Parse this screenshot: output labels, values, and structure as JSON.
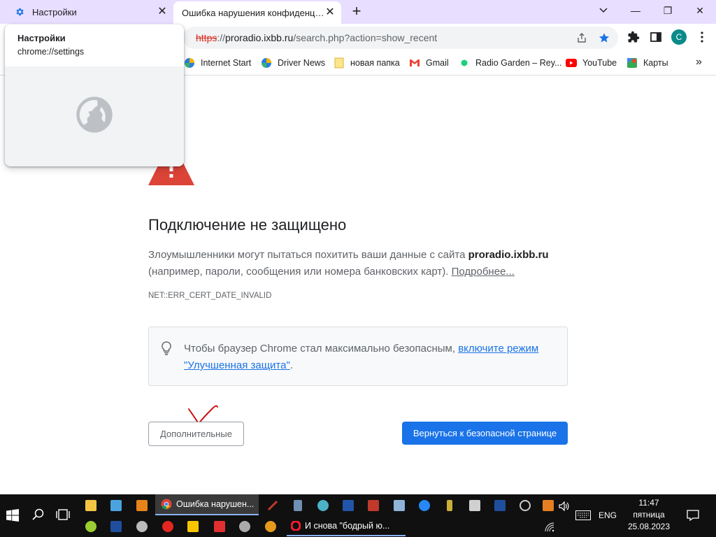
{
  "tabs": [
    {
      "title": "Настройки",
      "icon": "gear-icon",
      "active": false
    },
    {
      "title": "Ошибка нарушения конфиденциальности",
      "icon": "none",
      "active": true
    }
  ],
  "newtab_symbol": "+",
  "window_controls": {
    "minimize": "—",
    "restore": "❐",
    "close": "✕"
  },
  "omnibox": {
    "scheme": "https",
    "rest_prefix": "://",
    "host": "proradio.ixbb.ru",
    "path": "/search.php?action=show_recent"
  },
  "profile_initial": "C",
  "bookmarks": [
    {
      "label": "Internet Start",
      "icon": "internet-start-icon"
    },
    {
      "label": "Driver News",
      "icon": "driver-news-icon"
    },
    {
      "label": "новая папка",
      "icon": "folder-icon"
    },
    {
      "label": "Gmail",
      "icon": "gmail-icon"
    },
    {
      "label": "Radio Garden – Rey...",
      "icon": "radio-garden-icon"
    },
    {
      "label": "YouTube",
      "icon": "youtube-icon"
    },
    {
      "label": "Карты",
      "icon": "maps-icon"
    }
  ],
  "bookmarks_overflow": "»",
  "hovercard": {
    "title": "Настройки",
    "url": "chrome://settings"
  },
  "page": {
    "heading": "Подключение не защищено",
    "desc_prefix": "Злоумышленники могут пытаться похитить ваши данные с сайта ",
    "desc_host": "proradio.ixbb.ru",
    "desc_suffix": " (например, пароли, сообщения или номера банковских карт). ",
    "desc_link": "Подробнее...",
    "error_code": "NET::ERR_CERT_DATE_INVALID",
    "tip_prefix": "Чтобы браузер Chrome стал максимально безопасным, ",
    "tip_link": "включите режим \"Улучшенная защита\"",
    "tip_suffix": ".",
    "advanced_button": "Дополнительные",
    "back_button": "Вернуться к безопасной странице"
  },
  "taskbar": {
    "active_window": "Ошибка нарушен...",
    "second_window": "И снова \"бодрый ю...",
    "language": "ENG",
    "time": "11:47",
    "day": "пятница",
    "date": "25.08.2023"
  },
  "colors": {
    "tabstrip": "#e8deff",
    "accent_blue": "#1a73e8",
    "warning_red": "#db4437",
    "taskbar": "#101010"
  }
}
